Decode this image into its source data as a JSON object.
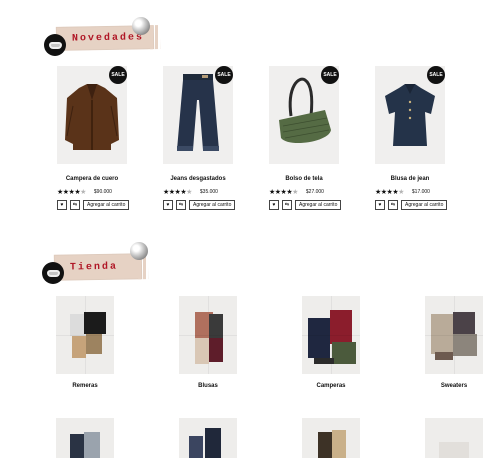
{
  "sections": {
    "novedades": {
      "title": "Novedades"
    },
    "tienda": {
      "title": "Tienda"
    }
  },
  "products": [
    {
      "name": "Campera de cuero",
      "price": "$90.000",
      "badge": "SALE",
      "rating": 4,
      "image": "leather-jacket"
    },
    {
      "name": "Jeans desgastados",
      "price": "$35.000",
      "badge": "SALE",
      "rating": 4,
      "image": "denim-jeans"
    },
    {
      "name": "Bolso de tela",
      "price": "$27.000",
      "badge": "SALE",
      "rating": 4,
      "image": "green-tote-bag"
    },
    {
      "name": "Blusa de jean",
      "price": "$17.000",
      "badge": "SALE",
      "rating": 4,
      "image": "denim-blouse"
    }
  ],
  "product_actions": {
    "wishlist_icon": "heart-icon",
    "compare_icon": "compare-arrows-icon",
    "add_to_cart_label": "Agregar al carrito"
  },
  "stars": {
    "full": "★★★★",
    "empty": "★"
  },
  "categories": [
    {
      "label": "Remeras",
      "image": "tshirts-collage"
    },
    {
      "label": "Blusas",
      "image": "blouses-collage"
    },
    {
      "label": "Camperas",
      "image": "jackets-collage"
    },
    {
      "label": "Sweaters",
      "image": "sweaters-collage"
    }
  ],
  "colors": {
    "accent_red": "#b01726",
    "banner_tape": "#e6d2c4",
    "badge_black": "#111111"
  }
}
